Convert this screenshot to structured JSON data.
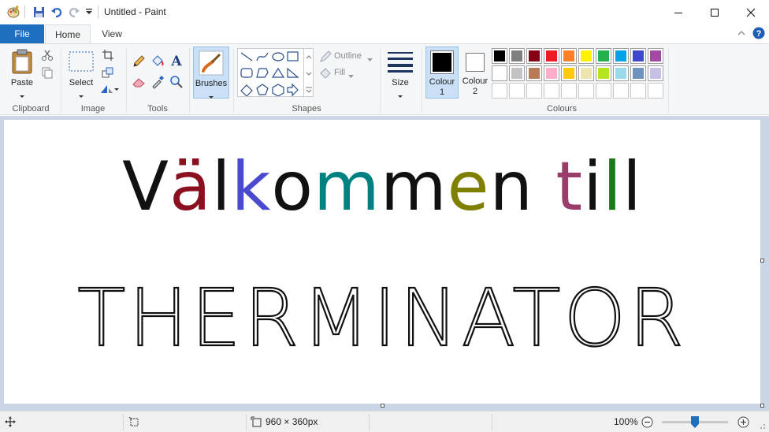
{
  "window": {
    "title": "Untitled - Paint"
  },
  "tabs": {
    "file": "File",
    "home": "Home",
    "view": "View"
  },
  "ribbon": {
    "clipboard": {
      "paste": "Paste",
      "label": "Clipboard"
    },
    "image": {
      "select": "Select",
      "label": "Image"
    },
    "tools": {
      "label": "Tools"
    },
    "brushes": {
      "label": "Brushes"
    },
    "shapes": {
      "outline": "Outline",
      "fill": "Fill",
      "label": "Shapes"
    },
    "size": {
      "label": "Size"
    },
    "colours": {
      "colour1": "Colour",
      "colour1_num": "1",
      "colour2": "Colour",
      "colour2_num": "2",
      "label": "Colours",
      "row1": [
        "#000000",
        "#7f7f7f",
        "#880015",
        "#ed1c24",
        "#ff7f27",
        "#fff200",
        "#22b14c",
        "#00a2e8",
        "#3f48cc",
        "#a349a4"
      ],
      "row2": [
        "#ffffff",
        "#c3c3c3",
        "#b97a57",
        "#ffaec9",
        "#ffc90e",
        "#efe4b0",
        "#b5e61d",
        "#99d9ea",
        "#7092be",
        "#c8bfe7"
      ]
    }
  },
  "canvas": {
    "line1": [
      {
        "text": "V",
        "color": "#111111"
      },
      {
        "text": "ä",
        "color": "#8a1020"
      },
      {
        "text": "l",
        "color": "#111111"
      },
      {
        "text": "k",
        "color": "#4a4ad0"
      },
      {
        "text": "o",
        "color": "#111111"
      },
      {
        "text": "m",
        "color": "#008080"
      },
      {
        "text": "m",
        "color": "#111111"
      },
      {
        "text": "e",
        "color": "#808000"
      },
      {
        "text": "n",
        "color": "#111111"
      },
      {
        "text": " ",
        "color": "#111111"
      },
      {
        "text": "t",
        "color": "#9a3d6a"
      },
      {
        "text": "i",
        "color": "#111111"
      },
      {
        "text": "l",
        "color": "#1a7a1a"
      },
      {
        "text": "l",
        "color": "#111111"
      }
    ],
    "line2": "THERMINATOR"
  },
  "status": {
    "dimensions": "960 × 360px",
    "zoom": "100%",
    "zoom_level": 100
  }
}
